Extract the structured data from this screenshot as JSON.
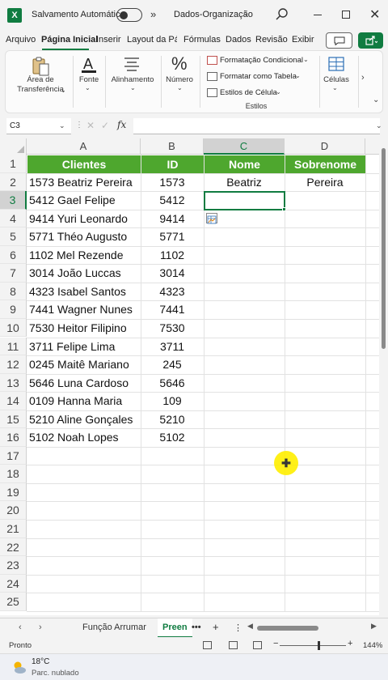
{
  "titlebar": {
    "autosave_label": "Salvamento Automático",
    "file_name": "Dados-Organização",
    "more_glyph": "»"
  },
  "ribbon_tabs": [
    "Arquivo",
    "Página Inicial",
    "Inserir",
    "Layout da Pág",
    "Fórmulas",
    "Dados",
    "Revisão",
    "Exibir"
  ],
  "ribbon_tabs_active_index": 1,
  "ribbon": {
    "clipboard_label": "Área de Transferência",
    "clipboard_line1": "Área de",
    "clipboard_line2": "Transferência",
    "font_label": "Fonte",
    "alignment_label": "Alinhamento",
    "number_label": "Número",
    "cond_format": "Formatação Condicional",
    "format_table": "Formatar como Tabela",
    "cell_styles": "Estilos de Célula",
    "styles_label": "Estilos",
    "cells_label": "Células"
  },
  "formula_bar": {
    "name_box": "C3",
    "fx": "fx",
    "value": ""
  },
  "grid": {
    "columns": [
      "A",
      "B",
      "C",
      "D"
    ],
    "rows": [
      "1",
      "2",
      "3",
      "4",
      "5",
      "6",
      "7",
      "8",
      "9",
      "10",
      "11",
      "12",
      "13",
      "14",
      "15",
      "16",
      "17",
      "18",
      "19",
      "20",
      "21",
      "22",
      "23",
      "24",
      "25"
    ],
    "header": {
      "A": "Clientes",
      "B": "ID",
      "C": "Nome",
      "D": "Sobrenome"
    },
    "data": [
      {
        "A": "1573 Beatriz Pereira",
        "B": "1573",
        "C": "Beatriz",
        "D": "Pereira"
      },
      {
        "A": "5412 Gael Felipe",
        "B": "5412",
        "C": "",
        "D": ""
      },
      {
        "A": "9414 Yuri Leonardo",
        "B": "9414",
        "C": "",
        "D": ""
      },
      {
        "A": "5771 Théo Augusto",
        "B": "5771",
        "C": "",
        "D": ""
      },
      {
        "A": "1102 Mel Rezende",
        "B": "1102",
        "C": "",
        "D": ""
      },
      {
        "A": "3014 João Luccas",
        "B": "3014",
        "C": "",
        "D": ""
      },
      {
        "A": "4323 Isabel Santos",
        "B": "4323",
        "C": "",
        "D": ""
      },
      {
        "A": "7441 Wagner Nunes",
        "B": "7441",
        "C": "",
        "D": ""
      },
      {
        "A": "7530 Heitor Filipino",
        "B": "7530",
        "C": "",
        "D": ""
      },
      {
        "A": "3711 Felipe Lima",
        "B": "3711",
        "C": "",
        "D": ""
      },
      {
        "A": "0245 Maitê Mariano",
        "B": "245",
        "C": "",
        "D": ""
      },
      {
        "A": "5646 Luna Cardoso",
        "B": "5646",
        "C": "",
        "D": ""
      },
      {
        "A": "0109 Hanna Maria",
        "B": "109",
        "C": "",
        "D": ""
      },
      {
        "A": "5210 Aline Gonçales",
        "B": "5210",
        "C": "",
        "D": ""
      },
      {
        "A": "5102 Noah Lopes",
        "B": "5102",
        "C": "",
        "D": ""
      }
    ],
    "selected_cell": "C3",
    "header_color": "#4ea72e",
    "accent_color": "#107c41"
  },
  "sheet_tabs": {
    "tabs": [
      "Função Arrumar",
      "Preen"
    ],
    "active_index": 1,
    "more": "•••",
    "add": "+"
  },
  "statusbar": {
    "status": "Pronto",
    "zoom": "144%"
  },
  "taskbar": {
    "temperature": "18°C",
    "condition": "Parc. nublado"
  }
}
